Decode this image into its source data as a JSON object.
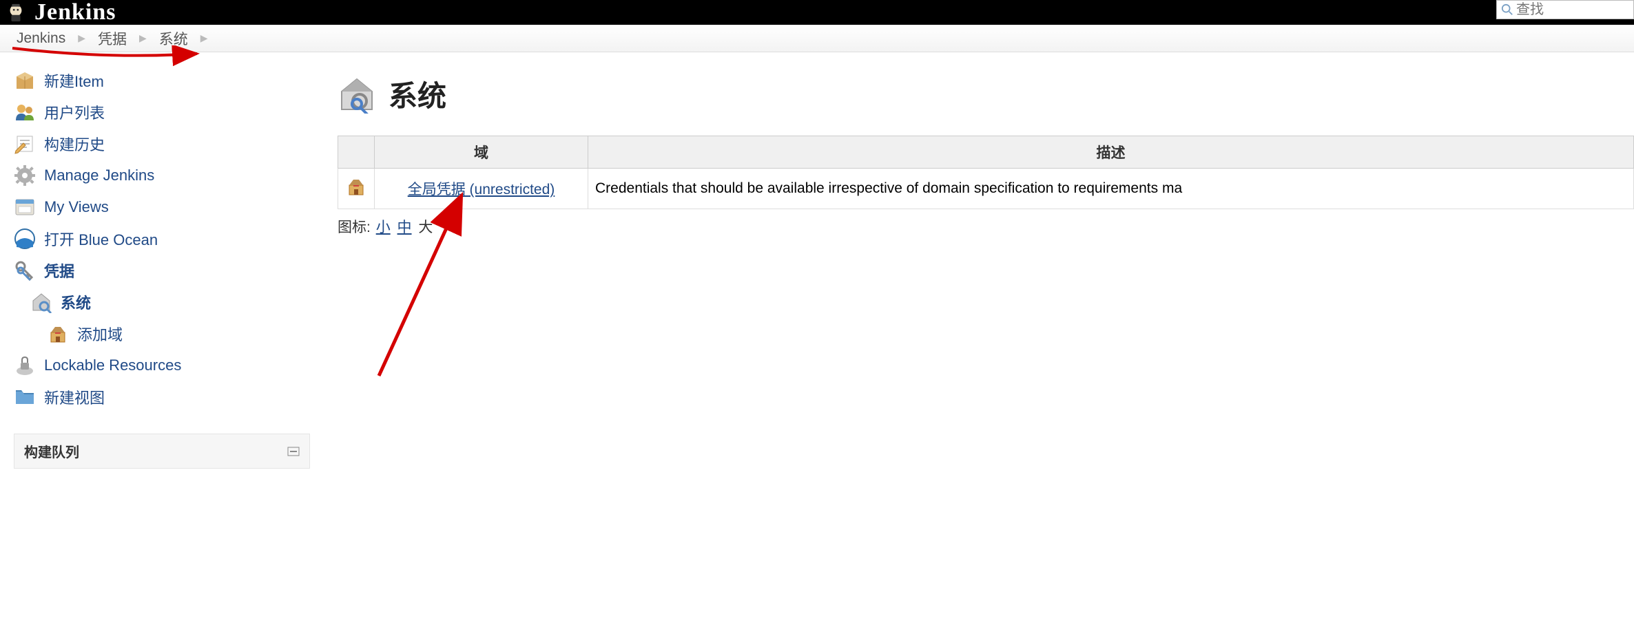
{
  "header": {
    "app_name": "Jenkins",
    "search_placeholder": "查找"
  },
  "breadcrumbs": [
    {
      "label": "Jenkins"
    },
    {
      "label": "凭据"
    },
    {
      "label": "系统"
    }
  ],
  "sidebar": {
    "items": [
      {
        "label": "新建Item",
        "icon": "package-icon",
        "bold": false,
        "indent": 0
      },
      {
        "label": "用户列表",
        "icon": "users-icon",
        "bold": false,
        "indent": 0
      },
      {
        "label": "构建历史",
        "icon": "notepad-icon",
        "bold": false,
        "indent": 0
      },
      {
        "label": "Manage Jenkins",
        "icon": "gear-icon",
        "bold": false,
        "indent": 0
      },
      {
        "label": "My Views",
        "icon": "window-icon",
        "bold": false,
        "indent": 0
      },
      {
        "label": "打开 Blue Ocean",
        "icon": "blueocean-icon",
        "bold": false,
        "indent": 0
      },
      {
        "label": "凭据",
        "icon": "keys-icon",
        "bold": true,
        "indent": 0
      },
      {
        "label": "系统",
        "icon": "system-icon",
        "bold": true,
        "indent": 1
      },
      {
        "label": "添加域",
        "icon": "domain-icon",
        "bold": false,
        "indent": 2
      },
      {
        "label": "Lockable Resources",
        "icon": "lock-icon",
        "bold": false,
        "indent": 0
      },
      {
        "label": "新建视图",
        "icon": "folder-icon",
        "bold": false,
        "indent": 0
      }
    ],
    "build_queue_title": "构建队列"
  },
  "main": {
    "title": "系统",
    "table": {
      "columns": [
        "",
        "域",
        "描述"
      ],
      "rows": [
        {
          "domain_link": "全局凭据 (unrestricted)",
          "description": "Credentials that should be available irrespective of domain specification to requirements ma"
        }
      ]
    },
    "icon_label": "图标:",
    "icon_sizes": [
      {
        "label": "小",
        "link": true
      },
      {
        "label": "中",
        "link": true
      },
      {
        "label": "大",
        "link": false
      }
    ]
  }
}
